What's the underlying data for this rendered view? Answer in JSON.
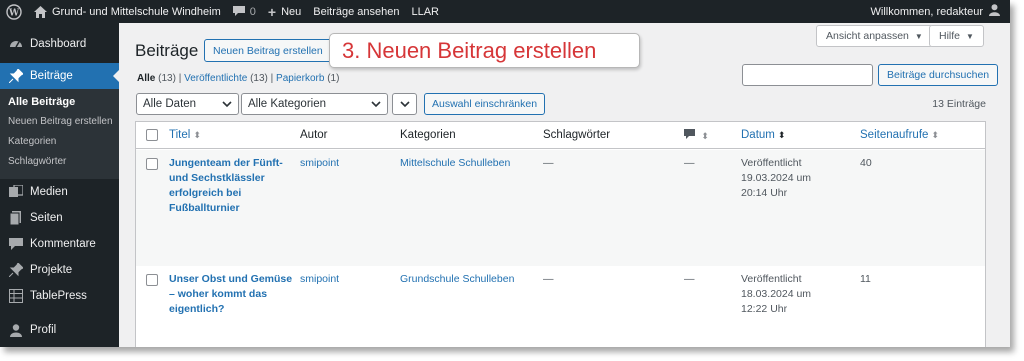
{
  "adminbar": {
    "site_name": "Grund- und Mittelschule Windheim",
    "comments_count": "0",
    "new_label": "Neu",
    "view_posts": "Beiträge ansehen",
    "llar": "LLAR",
    "greeting": "Willkommen, redakteur"
  },
  "sidebar": {
    "dashboard": "Dashboard",
    "posts": "Beiträge",
    "sub": [
      "Alle Beiträge",
      "Neuen Beitrag erstellen",
      "Kategorien",
      "Schlagwörter"
    ],
    "media": "Medien",
    "pages": "Seiten",
    "comments": "Kommentare",
    "projects": "Projekte",
    "tablepress": "TablePress",
    "profile": "Profil"
  },
  "header": {
    "title": "Beiträge",
    "add_new": "Neuen Beitrag erstellen",
    "screen_options": "Ansicht anpassen",
    "help": "Hilfe",
    "callout": "3. Neuen Beitrag erstellen"
  },
  "views": {
    "all": "Alle",
    "all_count": "(13)",
    "published": "Veröffentlichte",
    "published_count": "(13)",
    "trash": "Papierkorb",
    "trash_count": "(1)",
    "sep": "|"
  },
  "search": {
    "value": "",
    "button": "Beiträge durchsuchen"
  },
  "filters": {
    "dates": "Alle Daten",
    "categories": "Alle Kategorien",
    "bulk": "",
    "apply": "Auswahl einschränken",
    "item_count": "13 Einträge"
  },
  "table": {
    "headers": {
      "title": "Titel",
      "author": "Autor",
      "categories": "Kategorien",
      "tags": "Schlagwörter",
      "date": "Datum",
      "views": "Seitenaufrufe"
    },
    "rows": [
      {
        "title_lines": [
          "Jungenteam der Fünft-",
          "und Sechstklässler",
          "erfolgreich bei",
          "Fußballturnier"
        ],
        "author": "smipoint",
        "category": "Mittelschule Schulleben",
        "tags": "—",
        "comments": "—",
        "date_lines": [
          "Veröffentlicht",
          "19.03.2024 um",
          "20:14 Uhr"
        ],
        "views": "40"
      },
      {
        "title_lines": [
          "Unser Obst und Gemüse",
          "– woher kommt das",
          "eigentlich?"
        ],
        "author": "smipoint",
        "category": "Grundschule Schulleben",
        "tags": "—",
        "comments": "—",
        "date_lines": [
          "Veröffentlicht",
          "18.03.2024 um",
          "12:22 Uhr"
        ],
        "views": "11"
      }
    ]
  },
  "colors": {
    "accent": "#2271b1",
    "adminbar": "#1d2327",
    "callout_text": "#d63638"
  }
}
